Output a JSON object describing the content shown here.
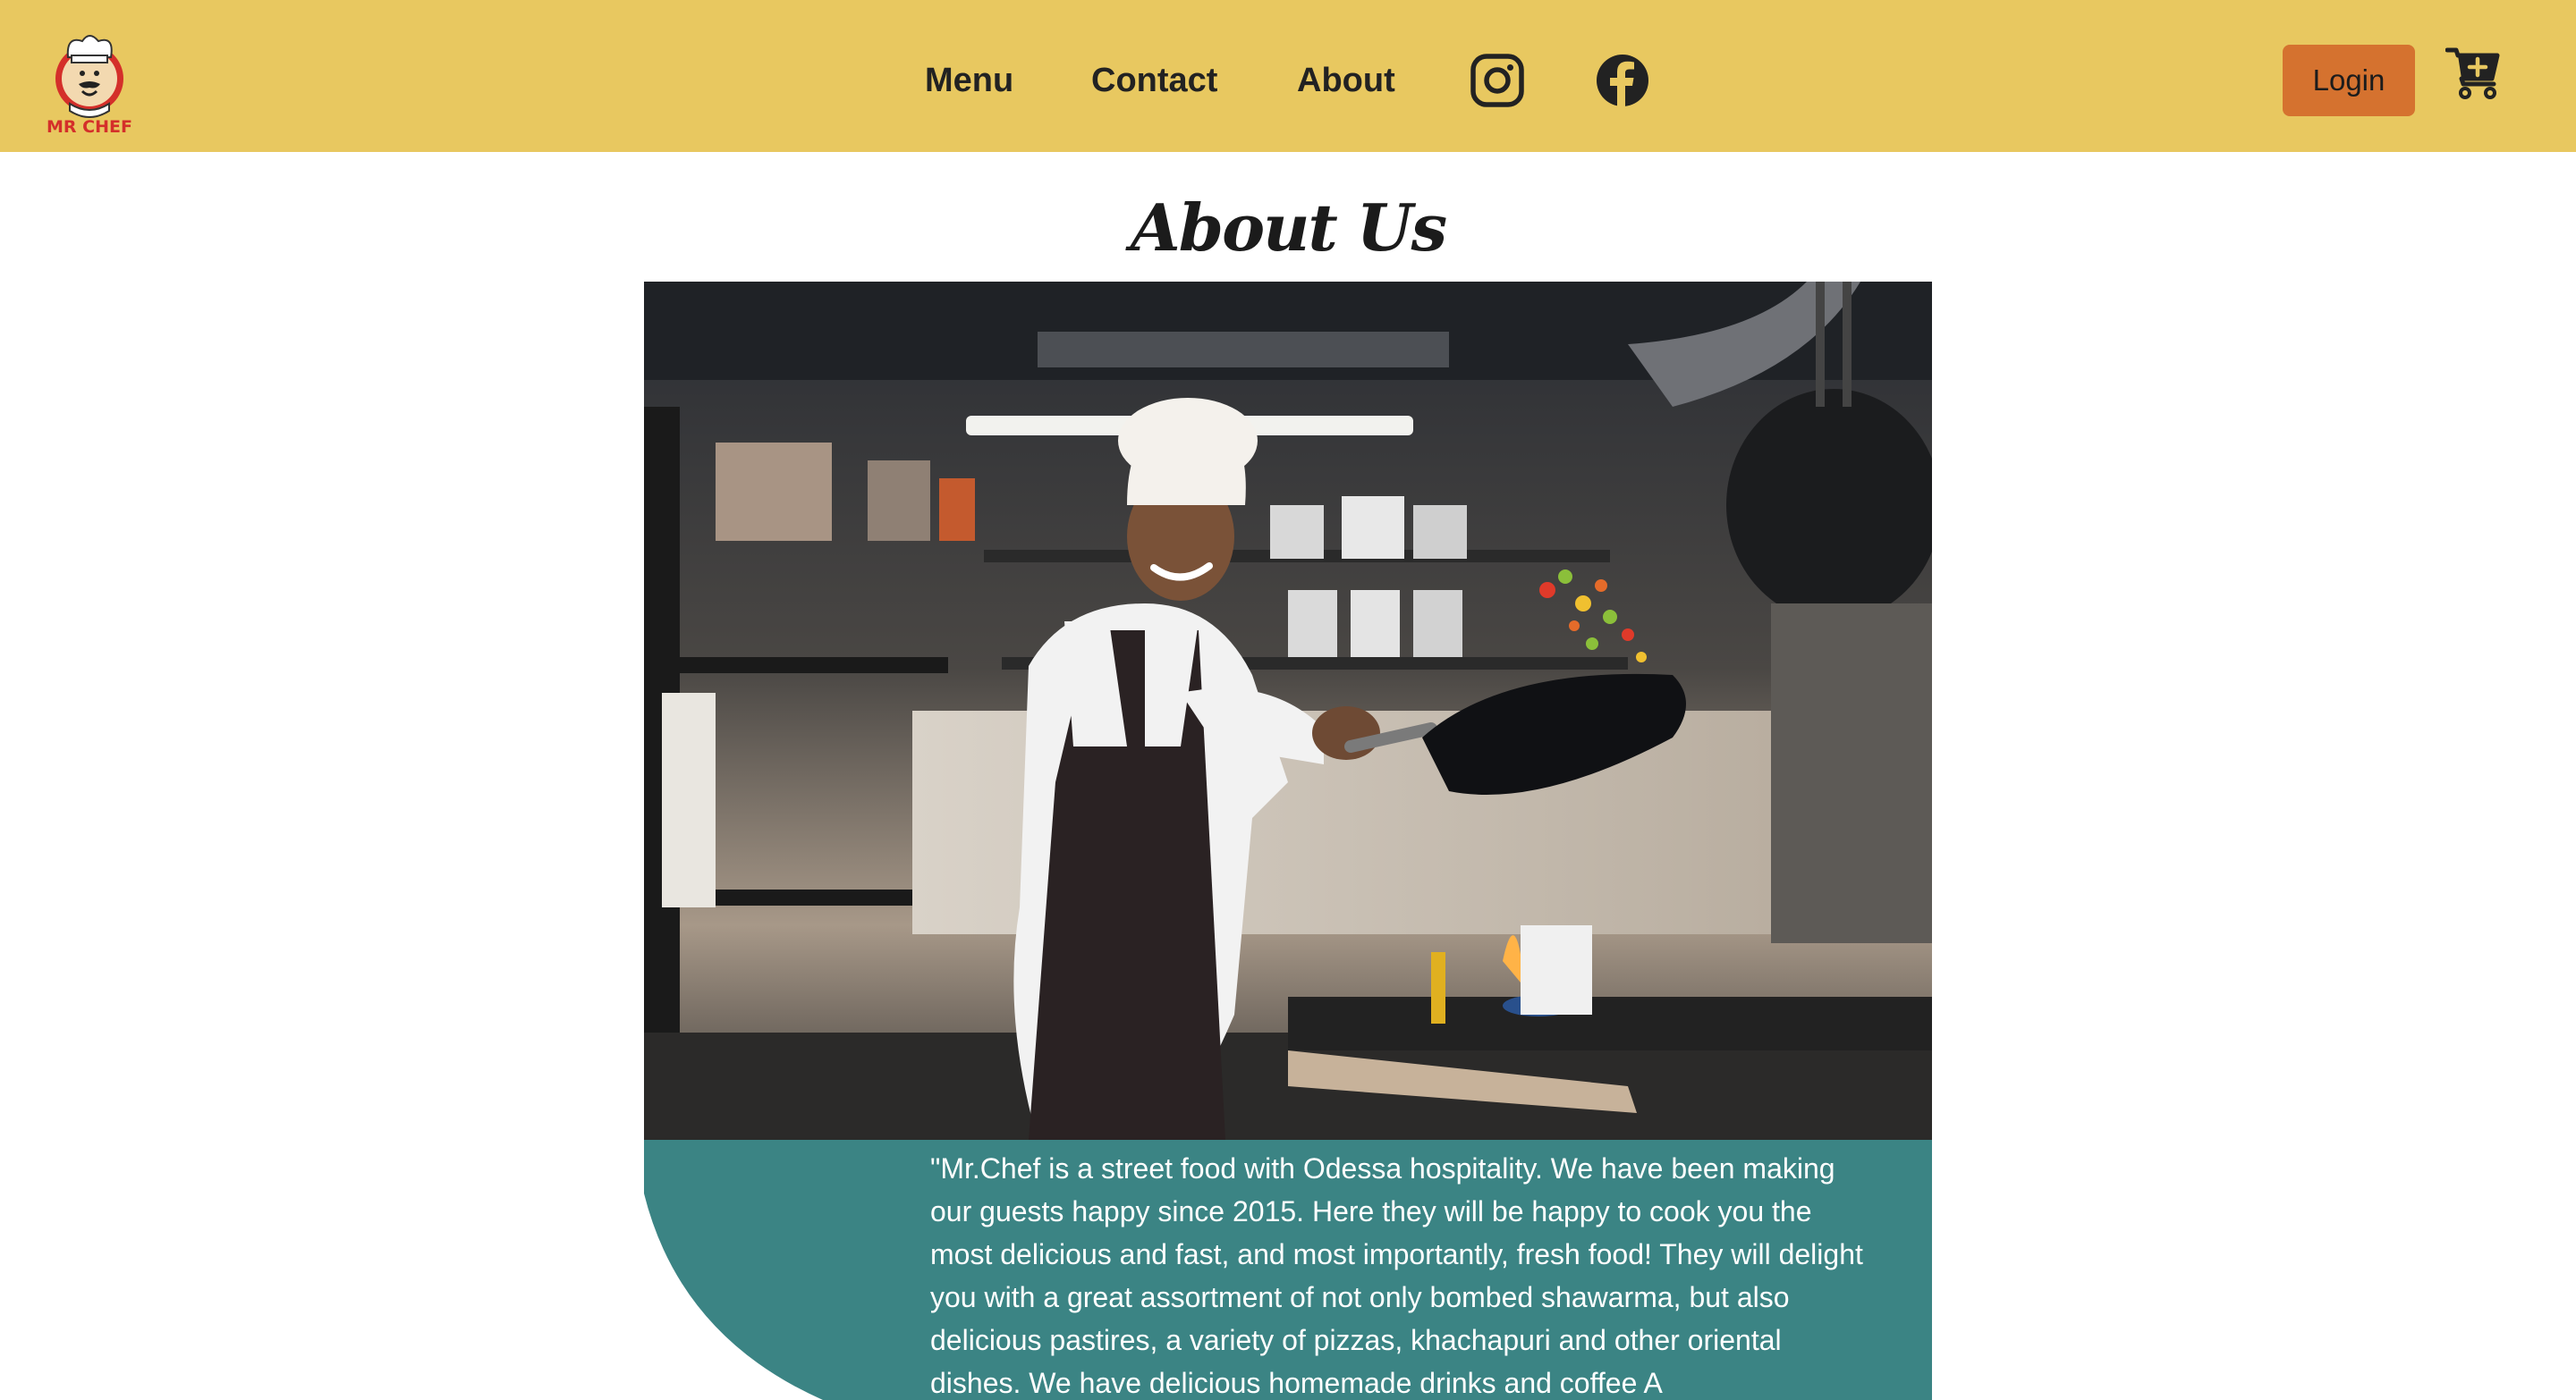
{
  "header": {
    "brand": "MR CHEF",
    "nav": {
      "menu": "Menu",
      "contact": "Contact",
      "about": "About"
    },
    "social": [
      "instagram-icon",
      "facebook-icon"
    ],
    "login_label": "Login",
    "cart_icon": "cart-plus-icon"
  },
  "main": {
    "title": "About Us",
    "image": "chef-tossing-vegetables-in-pan",
    "text": "\"Mr.Chef is a street food with Odessa hospitality. We have been making our guests happy since 2015. Here they will be happy to cook you the most delicious and fast, and most importantly, fresh food! They will delight you with a great assortment of not only bombed shawarma, but also delicious pastires, a variety of pizzas, khachapuri and other oriental dishes. We have delicious homemade drinks and coffee A"
  },
  "colors": {
    "header_bg": "#e8c860",
    "login_bg": "#d5722f",
    "teal": "#3b8484",
    "text_dark": "#222222"
  }
}
